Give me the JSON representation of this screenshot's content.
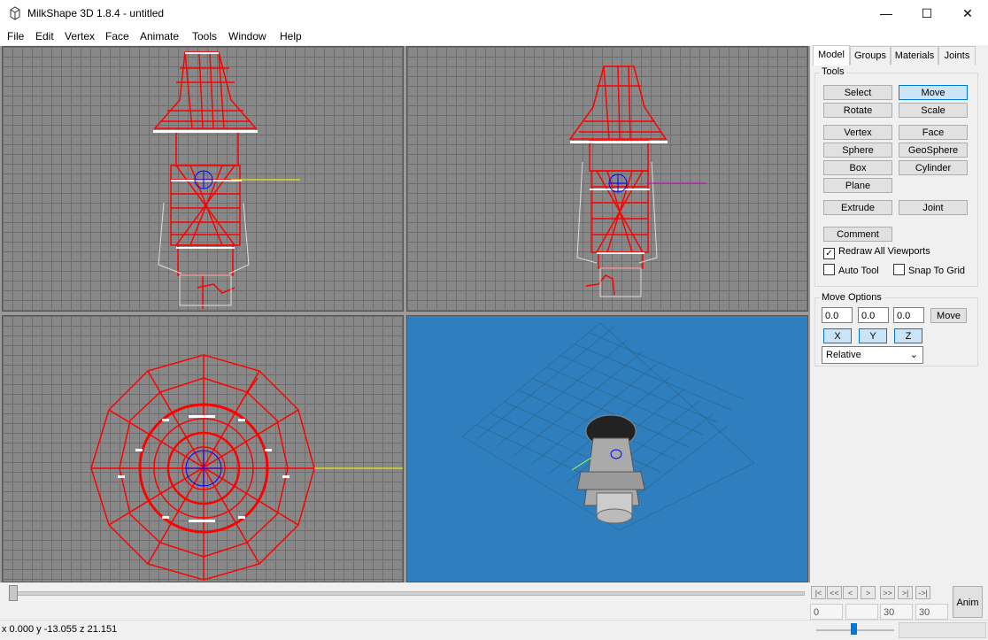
{
  "window": {
    "title": "MilkShape 3D 1.8.4 - untitled",
    "minimize": "—",
    "maximize": "☐",
    "close": "✕"
  },
  "menu": [
    "File",
    "Edit",
    "Vertex",
    "Face",
    "Animate",
    "Tools",
    "Window",
    "Help"
  ],
  "tabs": [
    "Model",
    "Groups",
    "Materials",
    "Joints"
  ],
  "tools": {
    "label": "Tools",
    "select": "Select",
    "move": "Move",
    "rotate": "Rotate",
    "scale": "Scale",
    "vertex": "Vertex",
    "face": "Face",
    "sphere": "Sphere",
    "geosphere": "GeoSphere",
    "box": "Box",
    "cylinder": "Cylinder",
    "plane": "Plane",
    "extrude": "Extrude",
    "joint": "Joint",
    "comment": "Comment",
    "redraw": "Redraw All Viewports",
    "auto_tool": "Auto Tool",
    "snap": "Snap To Grid",
    "redraw_checked": true,
    "auto_tool_checked": false,
    "snap_checked": false
  },
  "move_options": {
    "label": "Move Options",
    "x": "0.0",
    "y": "0.0",
    "z": "0.0",
    "move_btn": "Move",
    "axis_x": "X",
    "axis_y": "Y",
    "axis_z": "Z",
    "mode": "Relative"
  },
  "timeline": {
    "buttons": [
      "|<",
      "<<",
      "<",
      ">",
      ">>",
      ">|",
      "->|"
    ],
    "frame": "0",
    "blank": "",
    "current": "30",
    "total": "30",
    "anim": "Anim"
  },
  "status": {
    "coords": "x 0.000 y -13.055 z 21.151"
  },
  "colors": {
    "viewport_bg": "#888888",
    "perspective_bg": "#2f7fbf",
    "wire": "#ff0000",
    "accent": "#0078d7"
  }
}
